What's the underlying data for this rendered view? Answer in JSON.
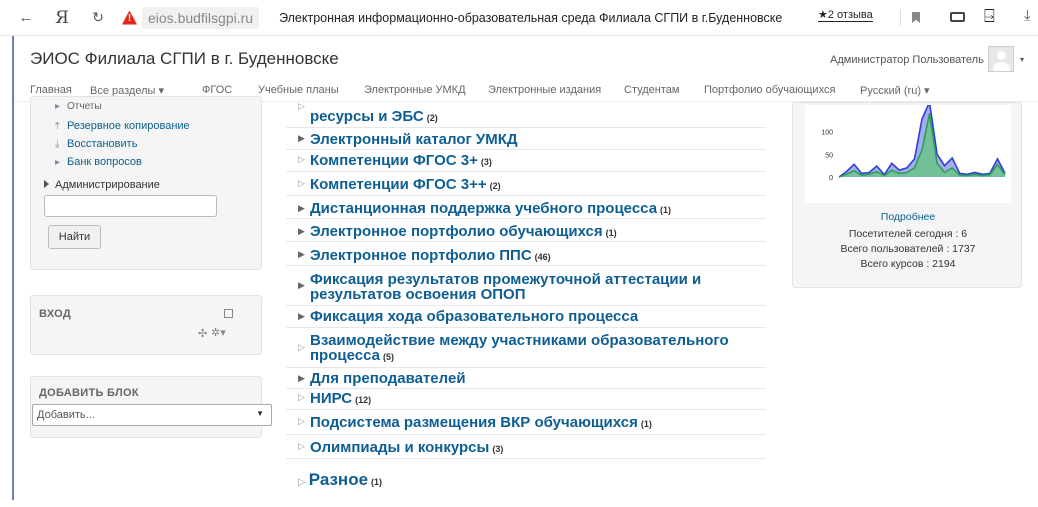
{
  "browser": {
    "back": "←",
    "yandex": "Я",
    "reload": "↻",
    "url": "eios.budfilsgpi.ru",
    "title": "Электронная информационно-образовательная среда Филиала СГПИ в г.Буденновске",
    "reviews": "★2 отзыва",
    "extension_icon": "⍈",
    "download_icon": "⤓"
  },
  "header": {
    "site_name": "ЭИОС Филиала СГПИ в г. Буденновске",
    "user_name": "Администратор Пользователь",
    "user_caret": "▾"
  },
  "nav": [
    {
      "label": "Главная"
    },
    {
      "label": "Все разделы ▾"
    },
    {
      "label": "ФГОС"
    },
    {
      "label": "Учебные планы"
    },
    {
      "label": "Электронные УМКД"
    },
    {
      "label": "Электронные издания"
    },
    {
      "label": "Студентам"
    },
    {
      "label": "Портфолио обучающихся"
    },
    {
      "label": "Русский (ru) ▾"
    }
  ],
  "admin_block": {
    "reports": "Отчеты",
    "backup": "Резервное копирование",
    "restore": "Восстановить",
    "question_bank": "Банк вопросов",
    "administration": "Администрирование",
    "search_placeholder": "",
    "find_button": "Найти"
  },
  "login_block": {
    "title": "ВХОД",
    "move_icon": "✣",
    "gear_icon": "✲▾"
  },
  "add_block": {
    "title": "ДОБАВИТЬ БЛОК",
    "select_value": "Добавить...",
    "select_caret": "▼"
  },
  "courses": [
    {
      "title": "ресурсы и ЭБС",
      "count": "(2)"
    },
    {
      "title": "Электронный каталог УМКД",
      "count": ""
    },
    {
      "title": "Компетенции ФГОС 3+",
      "count": "(3)"
    },
    {
      "title": "Компетенции ФГОС 3++",
      "count": "(2)"
    },
    {
      "title": "Дистанционная поддержка учебного процесса",
      "count": "(1)"
    },
    {
      "title": "Электронное портфолио обучающихся",
      "count": "(1)"
    },
    {
      "title": "Электронное портфолио ППС",
      "count": "(46)"
    },
    {
      "title_line1": "Фиксация результатов промежуточной аттестации и",
      "title_line2": "результатов освоения ОПОП",
      "count": ""
    },
    {
      "title": "Фиксация хода образовательного процесса",
      "count": ""
    },
    {
      "title_line1": "Взаимодействие между участниками образовательного",
      "title_line2": "процесса",
      "count": "(5)"
    },
    {
      "title": "Для преподавателей",
      "count": ""
    },
    {
      "title": "НИРС",
      "count": "(12)"
    },
    {
      "title": "Подсистема размещения ВКР обучающихся",
      "count": "(1)"
    },
    {
      "title": "Олимпиады и конкурсы",
      "count": "(3)"
    }
  ],
  "misc": {
    "title": "Разное",
    "count": "(1)"
  },
  "stats": {
    "more_link": "Подробнее",
    "visitors_today": "Посетителей сегодня : 6",
    "total_users": "Всего пользователей : 1737",
    "total_courses": "Всего курсов : 2194"
  },
  "chart_data": {
    "type": "area",
    "y_ticks": [
      "100",
      "50",
      "0"
    ],
    "ylim": [
      0,
      150
    ],
    "series": [
      {
        "color": "#2f3fd6",
        "values": [
          0,
          12,
          28,
          8,
          10,
          24,
          5,
          30,
          15,
          20,
          40,
          128,
          165,
          50,
          25,
          42,
          8,
          6,
          10,
          6,
          8,
          40,
          8
        ]
      },
      {
        "color": "#2f9e5a",
        "values": [
          0,
          6,
          14,
          4,
          6,
          12,
          3,
          15,
          8,
          10,
          20,
          60,
          140,
          30,
          10,
          20,
          4,
          3,
          6,
          3,
          5,
          28,
          5
        ]
      }
    ]
  }
}
